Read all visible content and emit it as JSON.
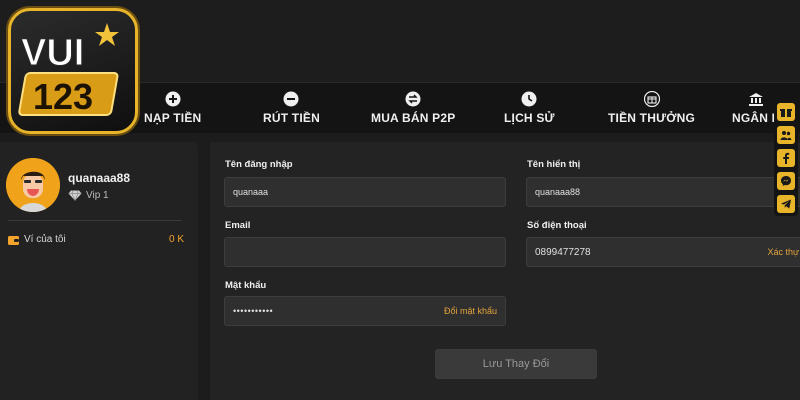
{
  "logo": {
    "text_top": "VUI",
    "text_bottom": "123"
  },
  "nav": [
    {
      "label": "NẠP TIỀN",
      "icon": "plus-circle-icon"
    },
    {
      "label": "RÚT TIỀN",
      "icon": "minus-circle-icon"
    },
    {
      "label": "MUA BÁN P2P",
      "icon": "exchange-icon"
    },
    {
      "label": "LỊCH SỬ",
      "icon": "clock-icon"
    },
    {
      "label": "TIỀN THƯỞNG",
      "icon": "gift-icon"
    },
    {
      "label": "NGÂN H",
      "icon": "bank-icon"
    }
  ],
  "profile": {
    "username": "quanaaa88",
    "vip": "Vip 1"
  },
  "wallet": {
    "label": "Ví của tôi",
    "value": "0 K"
  },
  "form": {
    "login_label": "Tên đăng nhập",
    "login_value": "quanaaa",
    "display_label": "Tên hiển thị",
    "display_value": "quanaaa88",
    "email_label": "Email",
    "email_value": "",
    "phone_label": "Số điện thoại",
    "phone_value": "0899477278",
    "phone_link": "Xác thự",
    "password_label": "Mật khẩu",
    "password_value": "•••••••••••",
    "password_link": "Đổi mật khẩu",
    "save_label": "Lưu Thay Đổi"
  },
  "float_icons": [
    "gift-icon",
    "user-group-icon",
    "facebook-icon",
    "messenger-icon",
    "telegram-icon"
  ],
  "colors": {
    "accent": "#e7b42a",
    "link": "#e4a53c",
    "wallet_value": "#f3a22a"
  }
}
